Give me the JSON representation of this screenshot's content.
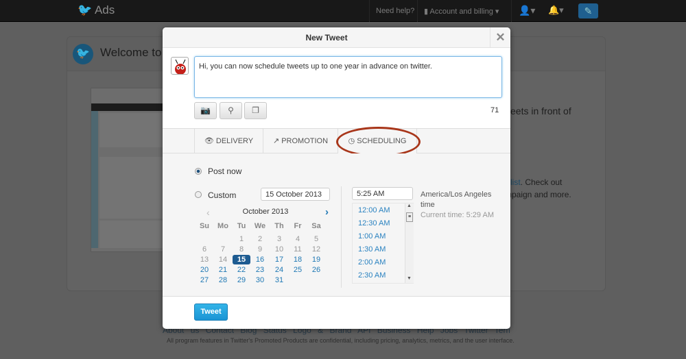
{
  "nav": {
    "brand": "Ads",
    "need_help": "Need help?",
    "account": "Account and billing",
    "icons": [
      "user-icon",
      "bell-icon",
      "compose-icon"
    ]
  },
  "background": {
    "welcome": "Welcome to T",
    "line1": "eets in front of",
    "line2_link": "list",
    "line2": ". Check out",
    "line3": "mpaign and more.",
    "footer_links": "About us Contact Blog Status Logo & Brand API Business Help Jobs Twitter Terms Privacy",
    "footer_note": "All program features in Twitter's Promoted Products are confidential, including pricing, analytics, metrics, and the user interface."
  },
  "modal": {
    "title": "New Tweet",
    "close": "✕",
    "tweet_text": "Hi, you can now schedule tweets up to one year in advance on twitter.",
    "char_count": "71",
    "toolbar": [
      "camera-icon",
      "location-icon",
      "media-icon"
    ],
    "tabs": [
      {
        "label": "DELIVERY",
        "icon": "eye-icon"
      },
      {
        "label": "PROMOTION",
        "icon": "arrow-icon"
      },
      {
        "label": "SCHEDULING",
        "icon": "clock-icon",
        "active": true
      }
    ],
    "scheduling": {
      "post_now": "Post now",
      "custom": "Custom",
      "selected": "post_now",
      "date_value": "15 October 2013",
      "calendar": {
        "month": "October 2013",
        "dow": [
          "Su",
          "Mo",
          "Tu",
          "We",
          "Th",
          "Fr",
          "Sa"
        ],
        "first_weekday": 2,
        "days": 31,
        "selected": 15
      },
      "time_value": "5:25 AM",
      "times": [
        "12:00 AM",
        "12:30 AM",
        "1:00 AM",
        "1:30 AM",
        "2:00 AM",
        "2:30 AM"
      ],
      "timezone": "America/Los Angeles",
      "timezone2": "time",
      "current_time": "Current time: 5:29 AM"
    },
    "tweet_button": "Tweet"
  },
  "colors": {
    "accent": "#1d5b91",
    "tweet_button": "#1a94d4",
    "highlight_ellipse": "#a8361a"
  }
}
